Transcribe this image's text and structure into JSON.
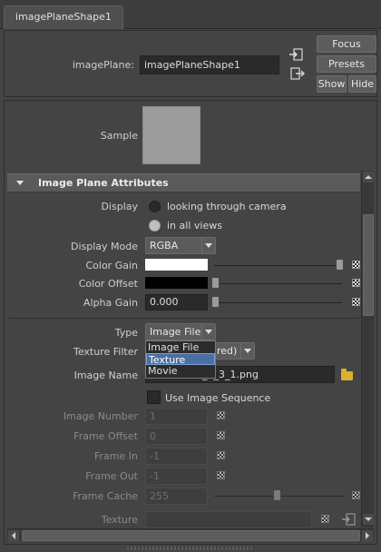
{
  "tab": {
    "label": "imagePlaneShape1"
  },
  "header": {
    "node_label": "imagePlane:",
    "node_value": "imagePlaneShape1",
    "focus_label": "Focus",
    "presets_label": "Presets",
    "show_label": "Show",
    "hide_label": "Hide"
  },
  "sample": {
    "label": "Sample"
  },
  "section": {
    "title": "Image Plane Attributes"
  },
  "attrs": {
    "display_label": "Display",
    "display_opt1": "looking through camera",
    "display_opt2": "in all views",
    "display_selected": "in all views",
    "display_mode_label": "Display Mode",
    "display_mode_value": "RGBA",
    "color_gain_label": "Color Gain",
    "color_gain_color": "#ffffff",
    "color_gain_slider": 1.0,
    "color_offset_label": "Color Offset",
    "color_offset_color": "#000000",
    "color_offset_slider": 0.0,
    "alpha_gain_label": "Alpha Gain",
    "alpha_gain_value": "0.000",
    "alpha_gain_slider": 0.0,
    "type_label": "Type",
    "type_value": "Image File",
    "type_options": [
      "Image File",
      "Texture",
      "Movie"
    ],
    "type_highlighted": "Texture",
    "texture_filter_label": "Texture Filter",
    "texture_filter_value": "red)",
    "image_name_label": "Image Name",
    "image_name_value": "_1_3_1.png",
    "use_seq_label": "Use Image Sequence",
    "image_number_label": "Image Number",
    "image_number_value": "1",
    "frame_offset_label": "Frame Offset",
    "frame_offset_value": "0",
    "frame_in_label": "Frame In",
    "frame_in_value": "-1",
    "frame_out_label": "Frame Out",
    "frame_out_value": "-1",
    "frame_cache_label": "Frame Cache",
    "frame_cache_value": "255",
    "frame_cache_slider": 0.5,
    "texture_label": "Texture"
  },
  "colors": {
    "panel": "#444444",
    "highlight": "#4a6fa0",
    "folder": "#d9b034"
  }
}
